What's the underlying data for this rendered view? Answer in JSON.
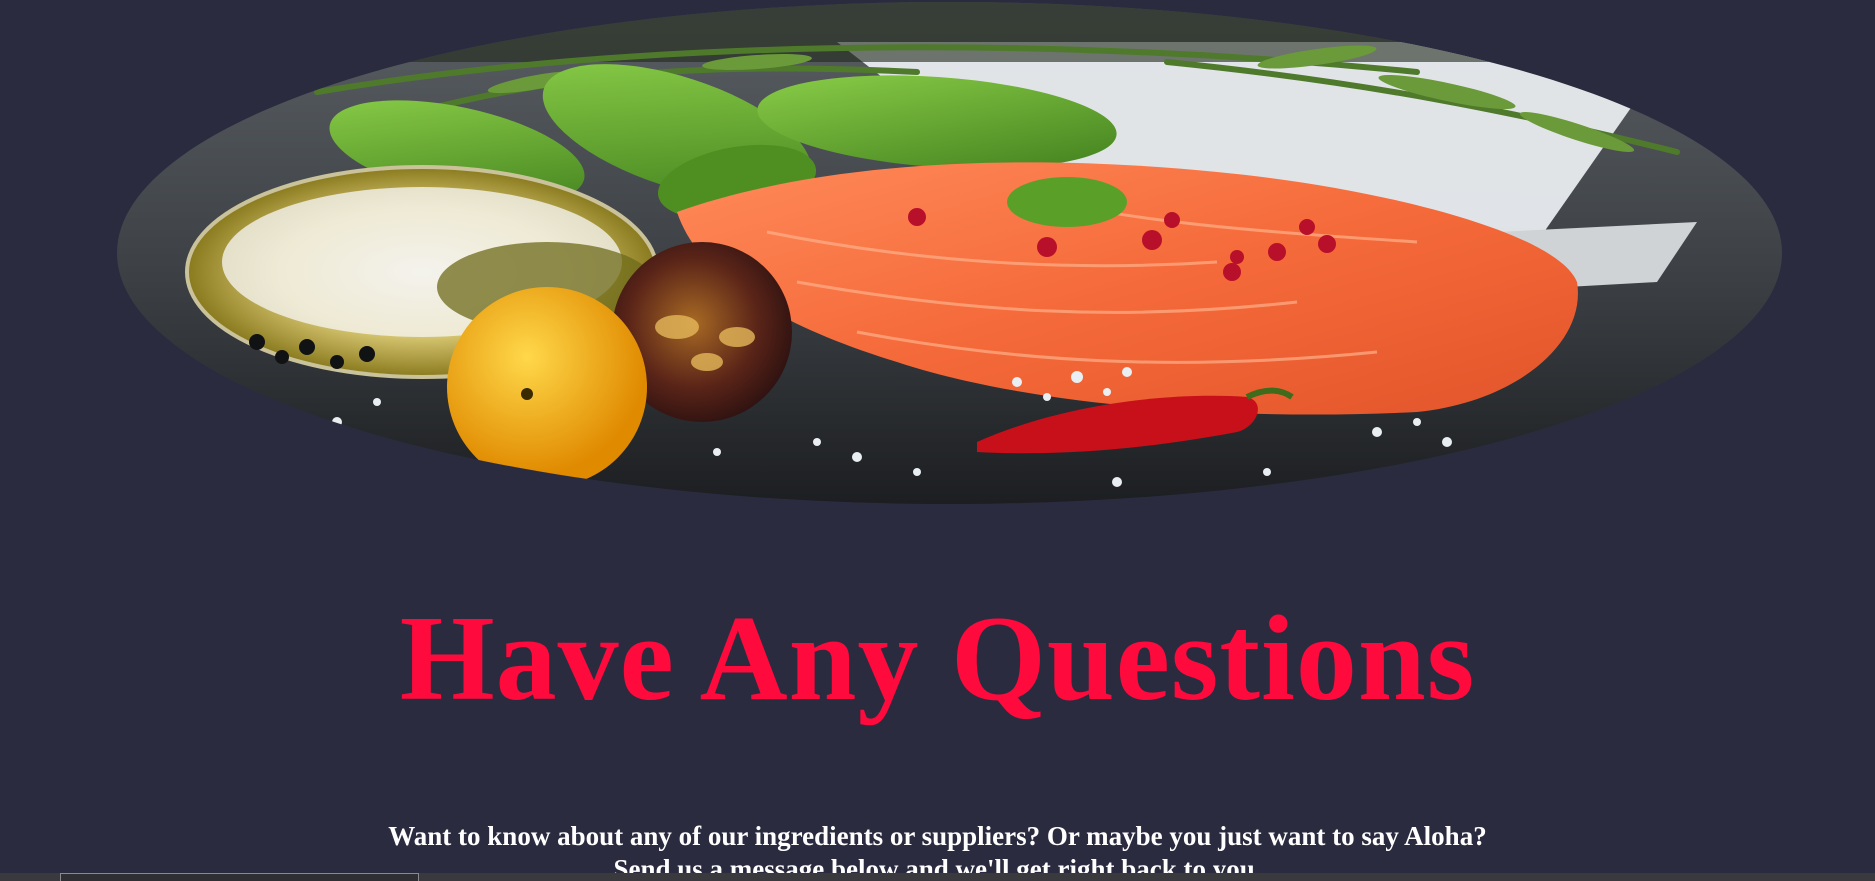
{
  "hero": {
    "image_alt": "Salmon fillet with olive oil, basil, tomatoes, chili and sea salt"
  },
  "colors": {
    "background": "#2b2b40",
    "heading": "#ff0a3c",
    "text": "#ffffff"
  },
  "contact": {
    "heading": "Have Any Questions",
    "line1": "Want to know about any of our ingredients or suppliers? Or maybe you just want to say Aloha?",
    "line2": "Send us a message below and we'll get right back to you."
  }
}
